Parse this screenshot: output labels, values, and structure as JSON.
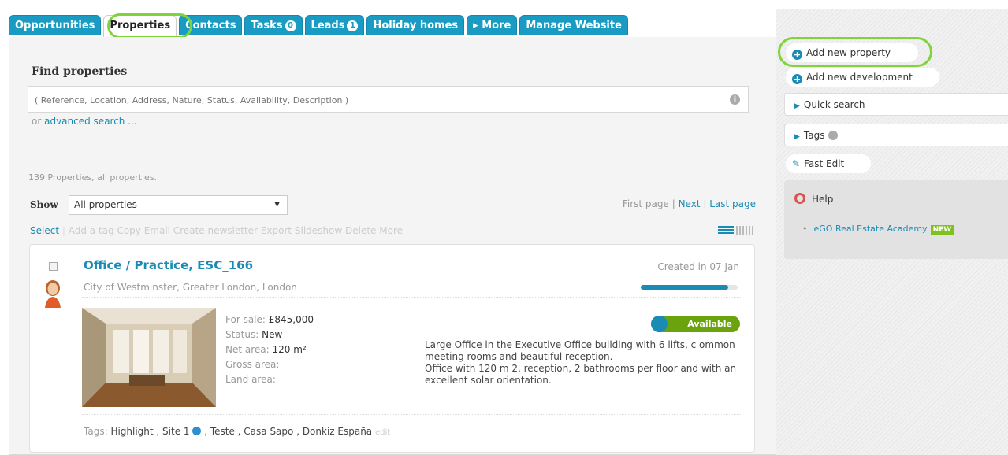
{
  "tabs": [
    {
      "label": "Opportunities"
    },
    {
      "label": "Properties",
      "active": true
    },
    {
      "label": "Contacts"
    },
    {
      "label": "Tasks",
      "badge": "0"
    },
    {
      "label": "Leads",
      "badge": "1"
    },
    {
      "label": "Holiday homes"
    },
    {
      "label": "▸ More"
    },
    {
      "label": "Manage Website"
    }
  ],
  "find": {
    "title": "Find properties",
    "placeholder": "( Reference, Location, Address, Nature, Status, Availability, Description )",
    "or_text": "or",
    "advanced_link": "advanced search ..."
  },
  "list": {
    "count_text": "139 Properties, all properties.",
    "show_label": "Show",
    "show_value": "All properties",
    "pager": {
      "first": "First page",
      "next": "Next",
      "last": "Last page"
    },
    "actions": {
      "select": "Select",
      "rest": "Add a tag Copy Email Create newsletter Export Slideshow Delete More"
    }
  },
  "property": {
    "title": "Office / Practice, ESC_166",
    "location": "City of Westminster, Greater London, London",
    "created": "Created in 07 Jan",
    "completeness": 0.9,
    "details": [
      {
        "key": "For sale:",
        "value": "£845,000"
      },
      {
        "key": "Status:",
        "value": "New"
      },
      {
        "key": "Net area:",
        "value": "120 m²"
      },
      {
        "key": "Gross area:",
        "value": ""
      },
      {
        "key": "Land area:",
        "value": ""
      }
    ],
    "availability": "Available",
    "description_1": "Large Office in the Executive Office building with 6 lifts, c ommon meeting rooms and beautiful reception.",
    "description_2": "Office with 120 m 2, reception, 2 bathrooms per floor and with an excellent solar orientation.",
    "tags_label": "Tags:",
    "tags_pre": "Highlight , Site 1",
    "tags_post": ", Teste , Casa Sapo , Donkiz España",
    "tags_edit": "edit"
  },
  "sidebar": {
    "add_property": "Add new property",
    "add_development": "Add new development",
    "quick_search": "Quick search",
    "tags": "Tags",
    "fast_edit": "Fast Edit",
    "help_title": "Help",
    "help_link": "eGO Real Estate Academy",
    "new_badge": "NEW"
  },
  "colors": {
    "accent": "#1a9bc4",
    "available": "#6aa30d",
    "highlight": "#7fd43a"
  }
}
